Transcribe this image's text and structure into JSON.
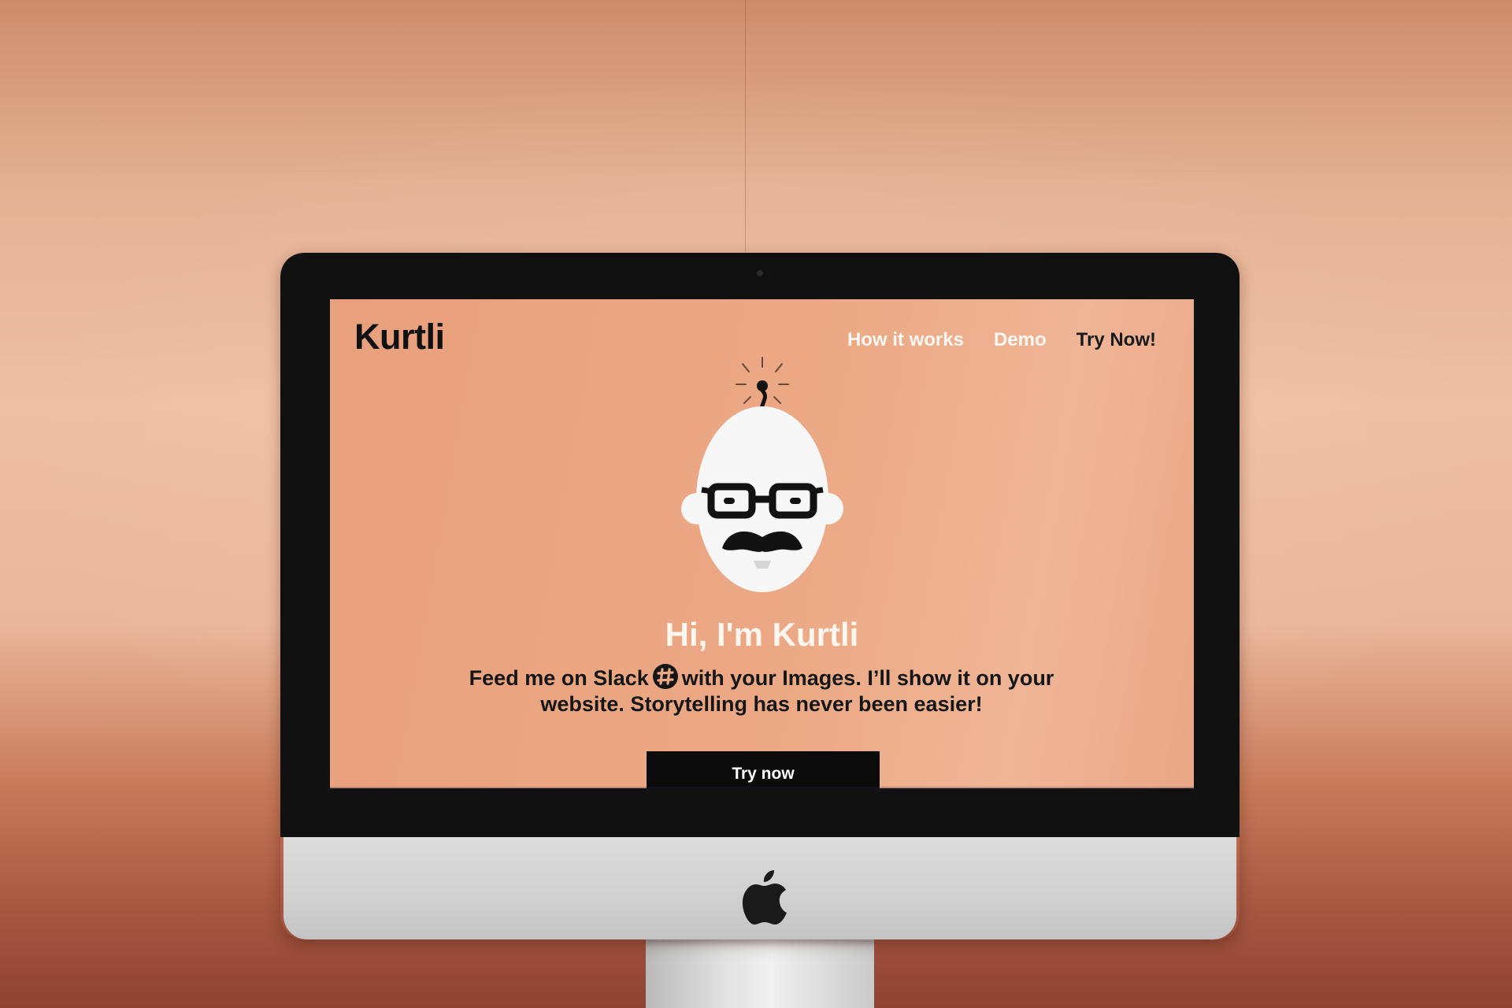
{
  "brand": {
    "logo_text": "Kurtli"
  },
  "nav": {
    "items": [
      {
        "label": "How it works"
      },
      {
        "label": "Demo"
      },
      {
        "label": "Try Now!"
      }
    ]
  },
  "hero": {
    "headline": "Hi, I'm Kurtli",
    "description_part1": "Feed me on Slack",
    "description_part2": "with your Images. I’ll show it on your website. Storytelling has never been easier!",
    "slack_icon": "slack-icon",
    "mascot_icon": "bald-man-with-glasses-and-mustache-icon",
    "cta_label": "Try now"
  },
  "colors": {
    "screen_background": "#eca985",
    "text_dark": "#151515",
    "text_light": "#fff6f0",
    "cta_background": "#0b0b0b",
    "wall": "#e3b092"
  }
}
